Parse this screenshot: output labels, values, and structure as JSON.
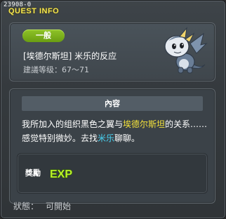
{
  "window": {
    "quest_id": "23908-0",
    "title": "QUEST INFO"
  },
  "quest": {
    "tier": "一般",
    "name": "[埃德尔斯坦] 米乐的反应",
    "level_label": "建議等级：",
    "level_range": "67～71",
    "npc_icon": "baby-dragon-icon"
  },
  "content": {
    "header": "內容",
    "segments": [
      {
        "text": "我所加入的组织黑色之翼与",
        "style": "normal"
      },
      {
        "text": "埃德尔斯坦",
        "style": "yellow"
      },
      {
        "text": "的关系……感觉特别微妙。去找",
        "style": "normal"
      },
      {
        "text": "米乐",
        "style": "blue"
      },
      {
        "text": "聊聊。",
        "style": "normal"
      }
    ]
  },
  "reward": {
    "label": "獎勵",
    "icon_text": "EXP"
  },
  "status": {
    "label": "狀態：",
    "value": "可開始"
  },
  "colors": {
    "title": "#f7e84f",
    "badge_green": "#7cb31a",
    "highlight_yellow": "#f3e13b",
    "highlight_blue": "#49d3f3",
    "exp_green": "#b8f02a"
  }
}
